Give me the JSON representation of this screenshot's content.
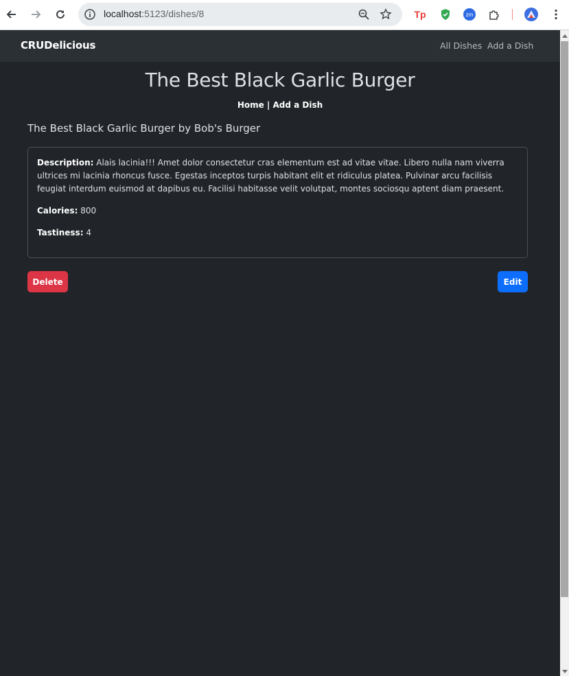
{
  "browser": {
    "url_host": "localhost",
    "url_path": ":5123/dishes/8",
    "icons": [
      "back-arrow-icon",
      "forward-arrow-icon",
      "reload-icon",
      "site-info-icon",
      "zoom-icon",
      "bookmark-star-icon",
      "extensions-puzzle-icon",
      "kebab-menu-icon"
    ],
    "ext_tp_label": "Tp",
    "ext_zm_label": "zm"
  },
  "navbar": {
    "brand": "CRUDelicious",
    "links": [
      "All Dishes",
      "Add a Dish"
    ]
  },
  "page": {
    "title": "The Best Black Garlic Burger",
    "subnav": {
      "home": "Home",
      "separator": " | ",
      "add": "Add a Dish"
    },
    "dish_heading": "The Best Black Garlic Burger by Bob's Burger",
    "details": {
      "description_label": "Description:",
      "description": "Alais lacinia!!! Amet dolor consectetur cras elementum est ad vitae vitae. Libero nulla nam viverra ultrices mi lacinia rhoncus fusce. Egestas inceptos turpis habitant elit et ridiculus platea. Pulvinar arcu facilisis feugiat interdum euismod at dapibus eu. Facilisi habitasse velit volutpat, montes sociosqu aptent diam praesent.",
      "calories_label": "Calories:",
      "calories": "800",
      "tastiness_label": "Tastiness:",
      "tastiness": "4"
    },
    "actions": {
      "delete": "Delete",
      "edit": "Edit"
    }
  },
  "colors": {
    "background": "#212529",
    "navbar": "#2b3035",
    "danger": "#dc3545",
    "primary": "#0d6efd"
  }
}
